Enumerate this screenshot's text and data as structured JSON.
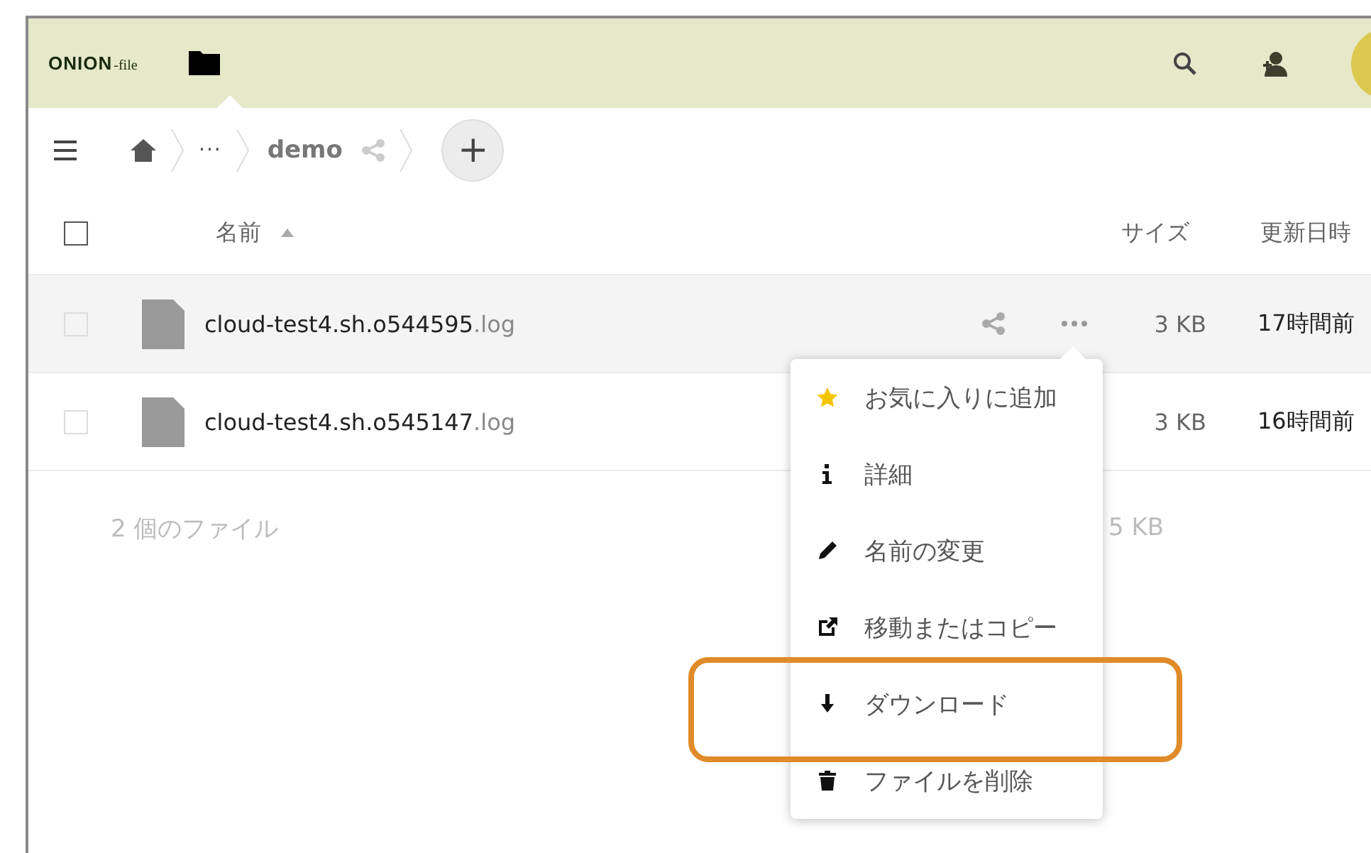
{
  "header": {
    "logo": {
      "main": "ONION",
      "suffix": "-file"
    }
  },
  "breadcrumb": {
    "ellipsis": "···",
    "folder": "demo",
    "add_label": "+"
  },
  "table": {
    "columns": [
      {
        "label": "名前",
        "sorted": true
      },
      {
        "label": "サイズ"
      },
      {
        "label": "更新日時"
      }
    ],
    "header_checked": false,
    "rows": [
      {
        "name": "cloud-test4.sh.o544595",
        "extension": ".log",
        "size": "3 KB",
        "modified": "17時間前",
        "selected": true,
        "checked": false
      },
      {
        "name": "cloud-test4.sh.o545147",
        "extension": ".log",
        "size": "3 KB",
        "modified": "16時間前",
        "selected": false,
        "checked": false
      }
    ],
    "summary": {
      "count": "2 個のファイル",
      "size": "5 KB"
    }
  },
  "context_menu": {
    "items": [
      {
        "kind": "star",
        "label": "お気に入りに追加",
        "highlighted": false
      },
      {
        "kind": "info",
        "label": "詳細",
        "highlighted": false
      },
      {
        "kind": "pencil",
        "label": "名前の変更",
        "highlighted": false
      },
      {
        "kind": "move",
        "label": "移動またはコピー",
        "highlighted": false
      },
      {
        "kind": "download",
        "label": "ダウンロード",
        "highlighted": true
      },
      {
        "kind": "trash",
        "label": "ファイルを削除",
        "highlighted": false
      }
    ]
  }
}
